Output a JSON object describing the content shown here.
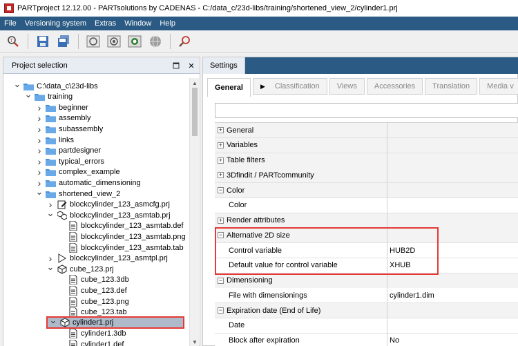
{
  "window": {
    "title": "PARTproject 12.12.00 - PARTsolutions by CADENAS - C:/data_c/23d-libs/training/shortened_view_2/cylinder1.prj"
  },
  "menu": [
    "File",
    "Versioning system",
    "Extras",
    "Window",
    "Help"
  ],
  "toolbar": {
    "icons": [
      "search-part-icon",
      "save-icon",
      "save-all-icon",
      "checkin-icon",
      "checkout-icon",
      "sync-icon",
      "globe-icon",
      "find-icon"
    ]
  },
  "left_panel": {
    "title": "Project selection",
    "tree": [
      {
        "label": "C:\\data_c\\23d-libs",
        "level": 0,
        "state": "expanded",
        "icon": "folder-icon"
      },
      {
        "label": "training",
        "level": 1,
        "state": "expanded",
        "icon": "folder-icon"
      },
      {
        "label": "beginner",
        "level": 2,
        "state": "collapsed",
        "icon": "folder-icon"
      },
      {
        "label": "assembly",
        "level": 2,
        "state": "collapsed",
        "icon": "folder-icon"
      },
      {
        "label": "subassembly",
        "level": 2,
        "state": "collapsed",
        "icon": "folder-icon"
      },
      {
        "label": "links",
        "level": 2,
        "state": "collapsed",
        "icon": "folder-icon"
      },
      {
        "label": "partdesigner",
        "level": 2,
        "state": "collapsed",
        "icon": "folder-icon"
      },
      {
        "label": "typical_errors",
        "level": 2,
        "state": "collapsed",
        "icon": "folder-icon"
      },
      {
        "label": "complex_example",
        "level": 2,
        "state": "collapsed",
        "icon": "folder-icon"
      },
      {
        "label": "automatic_dimensioning",
        "level": 2,
        "state": "collapsed",
        "icon": "folder-icon"
      },
      {
        "label": "shortened_view_2",
        "level": 2,
        "state": "expanded",
        "icon": "folder-icon"
      },
      {
        "label": "blockcylinder_123_asmcfg.prj",
        "level": 3,
        "state": "collapsed",
        "icon": "asmcfg-icon"
      },
      {
        "label": "blockcylinder_123_asmtab.prj",
        "level": 3,
        "state": "expanded",
        "icon": "assembly-icon"
      },
      {
        "label": "blockcylinder_123_asmtab.def",
        "level": 4,
        "state": "none",
        "icon": "file-icon"
      },
      {
        "label": "blockcylinder_123_asmtab.png",
        "level": 4,
        "state": "none",
        "icon": "file-icon"
      },
      {
        "label": "blockcylinder_123_asmtab.tab",
        "level": 4,
        "state": "none",
        "icon": "file-icon"
      },
      {
        "label": "blockcylinder_123_asmtpl.prj",
        "level": 3,
        "state": "collapsed",
        "icon": "template-icon"
      },
      {
        "label": "cube_123.prj",
        "level": 3,
        "state": "expanded",
        "icon": "cube-icon"
      },
      {
        "label": "cube_123.3db",
        "level": 4,
        "state": "none",
        "icon": "file-icon"
      },
      {
        "label": "cube_123.def",
        "level": 4,
        "state": "none",
        "icon": "file-icon"
      },
      {
        "label": "cube_123.png",
        "level": 4,
        "state": "none",
        "icon": "file-icon"
      },
      {
        "label": "cube_123.tab",
        "level": 4,
        "state": "none",
        "icon": "file-icon"
      },
      {
        "label": "cylinder1.prj",
        "level": 3,
        "state": "expanded",
        "icon": "cube-icon",
        "selected": true
      },
      {
        "label": "cylinder1.3db",
        "level": 4,
        "state": "none",
        "icon": "file-icon"
      },
      {
        "label": "cylinder1.def",
        "level": 4,
        "state": "none",
        "icon": "file-icon"
      }
    ]
  },
  "right_panel": {
    "title": "Settings",
    "tabs": [
      "General",
      "Classification",
      "Views",
      "Accessories",
      "Translation",
      "Media v"
    ],
    "active_tab": "General",
    "search_value": "",
    "rows": [
      {
        "label": "General",
        "value": "",
        "type": "group"
      },
      {
        "label": "Variables",
        "value": "",
        "type": "group"
      },
      {
        "label": "Table filters",
        "value": "",
        "type": "group"
      },
      {
        "label": "3Dfindit / PARTcommunity",
        "value": "",
        "type": "group"
      },
      {
        "label": "Color",
        "value": "",
        "type": "group-open"
      },
      {
        "label": "Color",
        "value": "",
        "type": "item"
      },
      {
        "label": "Render attributes",
        "value": "",
        "type": "group"
      },
      {
        "label": "Alternative 2D size",
        "value": "",
        "type": "group-open"
      },
      {
        "label": "Control variable",
        "value": "HUB2D",
        "type": "item"
      },
      {
        "label": "Default value for control variable",
        "value": "XHUB",
        "type": "item"
      },
      {
        "label": "Dimensioning",
        "value": "",
        "type": "group-open"
      },
      {
        "label": "File with dimensionings",
        "value": "cylinder1.dim",
        "type": "item"
      },
      {
        "label": "Expiration date (End of Life)",
        "value": "",
        "type": "group-open"
      },
      {
        "label": "Date",
        "value": "",
        "type": "item"
      },
      {
        "label": "Block after expiration",
        "value": "No",
        "type": "item"
      }
    ]
  },
  "colors": {
    "menubar": "#2b5b84",
    "folder": "#4a90d9",
    "selection": "#aeb9c9",
    "highlight": "#e53935"
  }
}
